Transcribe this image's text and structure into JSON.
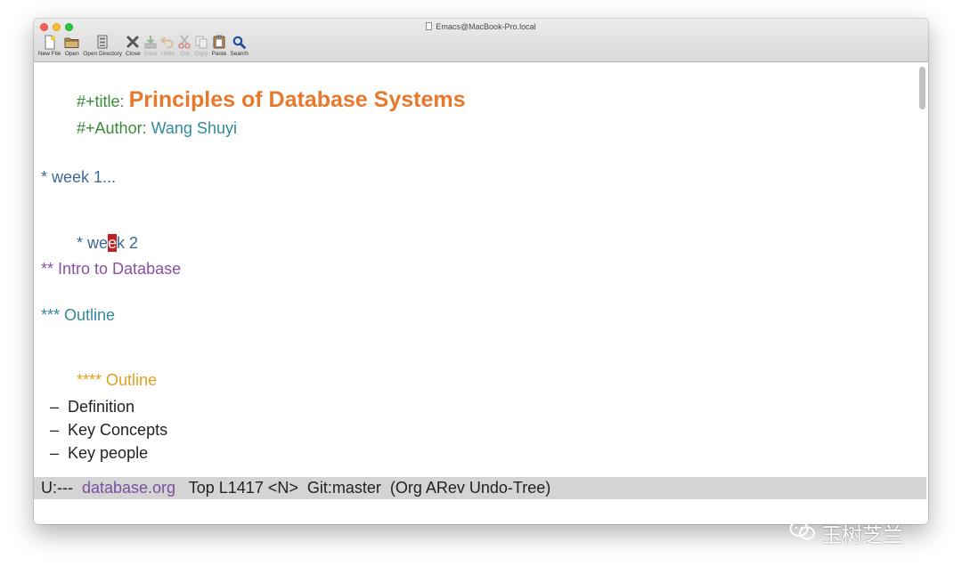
{
  "window": {
    "title": "Emacs@MacBook-Pro.local"
  },
  "toolbar": {
    "items": [
      {
        "label": "New File",
        "icon": "new-file-icon",
        "enabled": true
      },
      {
        "label": "Open",
        "icon": "open-folder-icon",
        "enabled": true
      },
      {
        "label": "Open Directory",
        "icon": "open-directory-icon",
        "enabled": true
      },
      {
        "label": "Close",
        "icon": "close-icon",
        "enabled": true
      },
      {
        "label": "Save",
        "icon": "save-icon",
        "enabled": false
      },
      {
        "label": "Undo",
        "icon": "undo-icon",
        "enabled": false
      },
      {
        "label": "Cut",
        "icon": "cut-icon",
        "enabled": false
      },
      {
        "label": "Copy",
        "icon": "copy-icon",
        "enabled": false
      },
      {
        "label": "Paste",
        "icon": "paste-icon",
        "enabled": true
      },
      {
        "label": "Search",
        "icon": "search-icon",
        "enabled": true
      }
    ]
  },
  "buffer": {
    "title_keyword": "#+title: ",
    "title_value": "Principles of Database Systems",
    "author_keyword": "#+Author: ",
    "author_value": "Wang Shuyi",
    "week1": "* week 1...",
    "week2_before_cursor": "* we",
    "week2_cursor_char": "e",
    "week2_after_cursor": "k 2",
    "intro": "** Intro to Database",
    "outline3": "*** Outline",
    "outline4_stars": "****",
    "outline4_text": " Outline",
    "list_items": [
      "  –  Definition",
      "  –  Key Concepts",
      "  –  Key people"
    ]
  },
  "modeline": {
    "status": "U:---  ",
    "buffer_name": "database.org",
    "rest": "   Top L1417 <N>  Git:master  (Org ARev Undo-Tree)"
  },
  "watermark": {
    "text": "玉树芝兰"
  },
  "colors": {
    "keyword": "#3a8a3a",
    "title": "#e8782a",
    "author": "#2f8b9a",
    "heading1": "#3c6a9a",
    "heading2": "#8a4fa8",
    "heading3": "#2f8b9a",
    "heading4": "#e0a020",
    "cursor": "#c41e1e",
    "modeline_bg": "#d4d4d4"
  }
}
